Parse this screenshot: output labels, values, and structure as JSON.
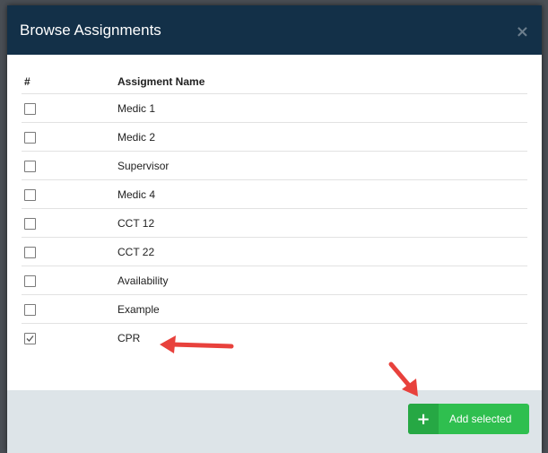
{
  "modal": {
    "title": "Browse Assignments",
    "close_icon": "×"
  },
  "table": {
    "headers": [
      "#",
      "Assigment Name"
    ],
    "rows": [
      {
        "name": "Medic 1",
        "checked": false
      },
      {
        "name": "Medic 2",
        "checked": false
      },
      {
        "name": "Supervisor",
        "checked": false
      },
      {
        "name": "Medic 4",
        "checked": false
      },
      {
        "name": "CCT 12",
        "checked": false
      },
      {
        "name": "CCT 22",
        "checked": false
      },
      {
        "name": "Availability",
        "checked": false
      },
      {
        "name": "Example",
        "checked": false
      },
      {
        "name": "CPR",
        "checked": true
      }
    ]
  },
  "footer": {
    "add_button_icon": "+",
    "add_button_label": "Add selected"
  },
  "colors": {
    "header_bg": "#133048",
    "footer_bg": "#dde4e8",
    "button_green": "#2fbf4f",
    "annotation_arrow": "#e8413c"
  },
  "annotations": [
    "arrow-pointing-to-cpr-row",
    "arrow-pointing-to-add-selected-button"
  ]
}
